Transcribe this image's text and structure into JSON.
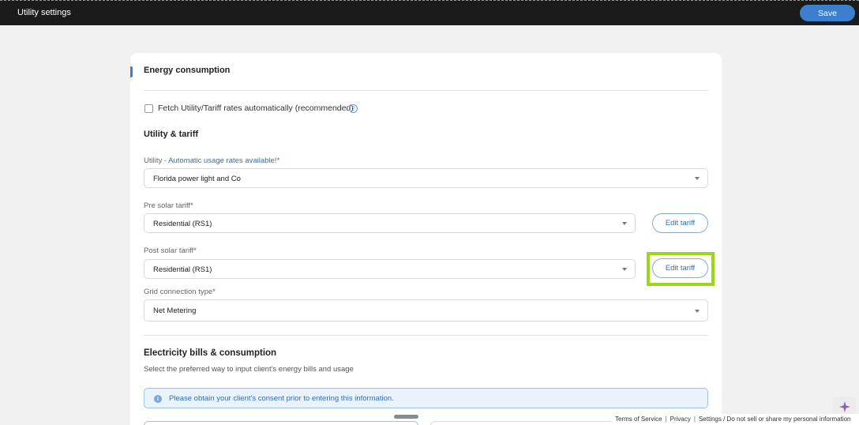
{
  "header": {
    "title": "Utility settings",
    "save_label": "Save"
  },
  "energy": {
    "heading": "Energy consumption",
    "fetch_checkbox_label": "Fetch Utility/Tariff rates automatically (recommended)",
    "fetch_checked": false,
    "utility_tariff_heading": "Utility & tariff",
    "utility": {
      "label": "Utility - ",
      "label_link": "Automatic usage rates available!",
      "label_required": "*",
      "value": "Florida power light and Co"
    },
    "pre_solar": {
      "label": "Pre solar tariff*",
      "value": "Residential (RS1)",
      "edit_label": "Edit tariff"
    },
    "post_solar": {
      "label": "Post solar tariff*",
      "value": "Residential (RS1)",
      "edit_label": "Edit tariff"
    },
    "grid": {
      "label": "Grid connection type*",
      "value": "Net Metering"
    }
  },
  "electricity": {
    "heading": "Electricity bills & consumption",
    "subtitle": "Select the preferred way to input client's energy bills and usage",
    "consent_notice": "Please obtain your client's consent prior to entering this information."
  },
  "footer": {
    "terms": "Terms of Service",
    "privacy": "Privacy",
    "settings": "Settings / Do not sell or share my personal information"
  },
  "colors": {
    "accent": "#3b7fce",
    "highlight": "#9bd617",
    "topbar": "#1b1b1b"
  },
  "icons": {
    "help": "question-circle-icon",
    "info": "info-icon",
    "dropdown": "chevron-down-icon",
    "assistant": "sparkle-icon"
  }
}
